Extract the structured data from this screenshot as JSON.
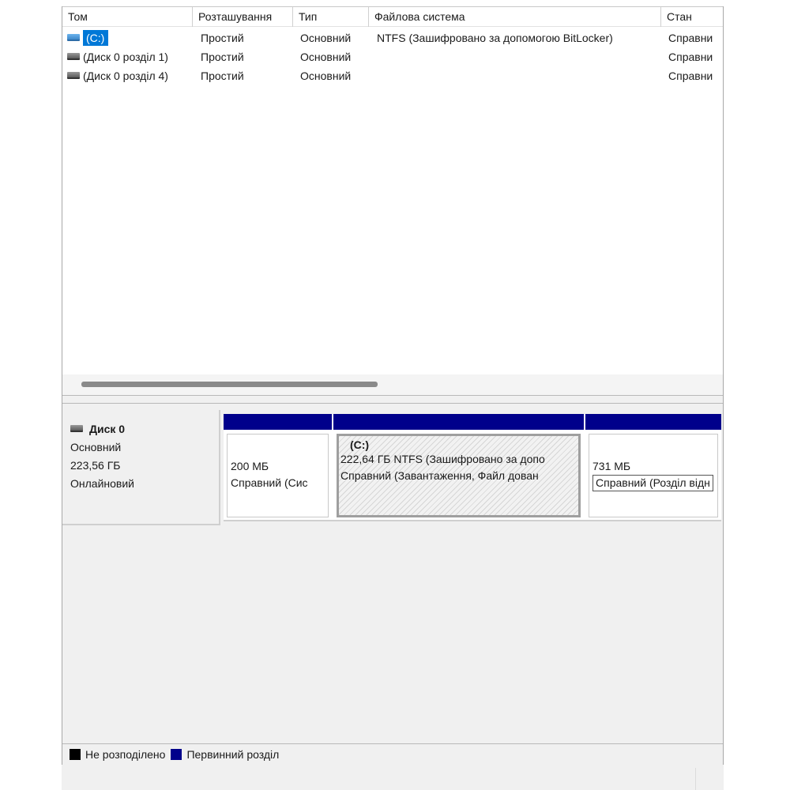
{
  "volume_list": {
    "columns": [
      "Том",
      "Розташування",
      "Тип",
      "Файлова система",
      "Стан"
    ],
    "rows": [
      {
        "name": "(C:)",
        "layout": "Простий",
        "type": "Основний",
        "fs": "NTFS (Зашифровано за допомогою BitLocker)",
        "status": "Справни",
        "icon": "drive-blue-icon",
        "selected": true
      },
      {
        "name": "(Диск 0 розділ 1)",
        "layout": "Простий",
        "type": "Основний",
        "fs": "",
        "status": "Справни",
        "icon": "drive-gray-icon",
        "selected": false
      },
      {
        "name": "(Диск 0 розділ 4)",
        "layout": "Простий",
        "type": "Основний",
        "fs": "",
        "status": "Справни",
        "icon": "drive-gray-icon",
        "selected": false
      }
    ]
  },
  "disk": {
    "title": "Диск 0",
    "type": "Основний",
    "size": "223,56 ГБ",
    "status": "Онлайновий",
    "icon": "disk-drive-icon",
    "partitions": [
      {
        "size": "200 МБ",
        "status": "Справний (Сис"
      },
      {
        "label": "(C:)",
        "size": "222,64 ГБ NTFS (Зашифровано за допо",
        "status": "Справний (Завантаження, Файл дован"
      },
      {
        "size": "731 МБ",
        "status": "Справний (Розділ відн"
      }
    ]
  },
  "legend": {
    "unallocated": "Не розподілено",
    "primary": "Первинний розділ",
    "unallocated_color": "#000000",
    "primary_color": "#00008b"
  },
  "colors": {
    "selection": "#0078d7",
    "partition_bar": "#00008b"
  }
}
